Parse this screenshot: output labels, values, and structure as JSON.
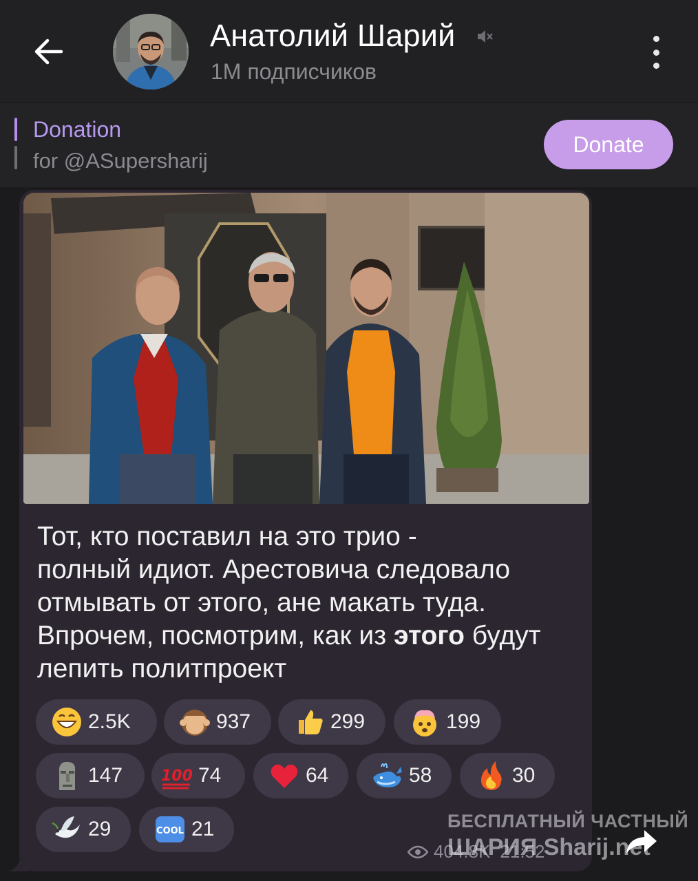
{
  "header": {
    "title": "Анатолий Шарий",
    "subscribers": "1M подписчиков"
  },
  "pinned": {
    "title": "Donation",
    "subtitle": "for @ASupersharij",
    "button": "Donate"
  },
  "message": {
    "line1": "Тот, кто поставил на это трио -",
    "line2": "полный идиот. Арестовича следовало",
    "line3": "отмывать от этого,  ане макать туда.",
    "line4a": "Впрочем, посмотрим, как из ",
    "line4b": "этого",
    "line4c": " будут",
    "line5": "лепить политпроект",
    "views": "404.8K",
    "time": "21:52"
  },
  "reactions": [
    {
      "icon": "grinning-face-icon",
      "count": "2.5K"
    },
    {
      "icon": "see-no-evil-monkey-icon",
      "count": "937"
    },
    {
      "icon": "thumbs-up-icon",
      "count": "299"
    },
    {
      "icon": "exploding-head-icon",
      "count": "199"
    },
    {
      "icon": "moai-icon",
      "count": "147"
    },
    {
      "icon": "hundred-points-icon",
      "count": "74"
    },
    {
      "icon": "red-heart-icon",
      "count": "64"
    },
    {
      "icon": "whale-icon",
      "count": "58"
    },
    {
      "icon": "fire-icon",
      "count": "30"
    },
    {
      "icon": "dove-icon",
      "count": "29"
    },
    {
      "icon": "cool-button-icon",
      "count": "21"
    }
  ],
  "watermark": {
    "line1": "БЕСПЛАТНЫЙ ЧАСТНЫЙ",
    "line2": "ШАРИЯ Sharij.net"
  },
  "colors": {
    "accent": "#c79ce8",
    "pinned_title": "#b79af0",
    "bubble": "#2b2630",
    "reaction_bg": "#3f3847"
  }
}
